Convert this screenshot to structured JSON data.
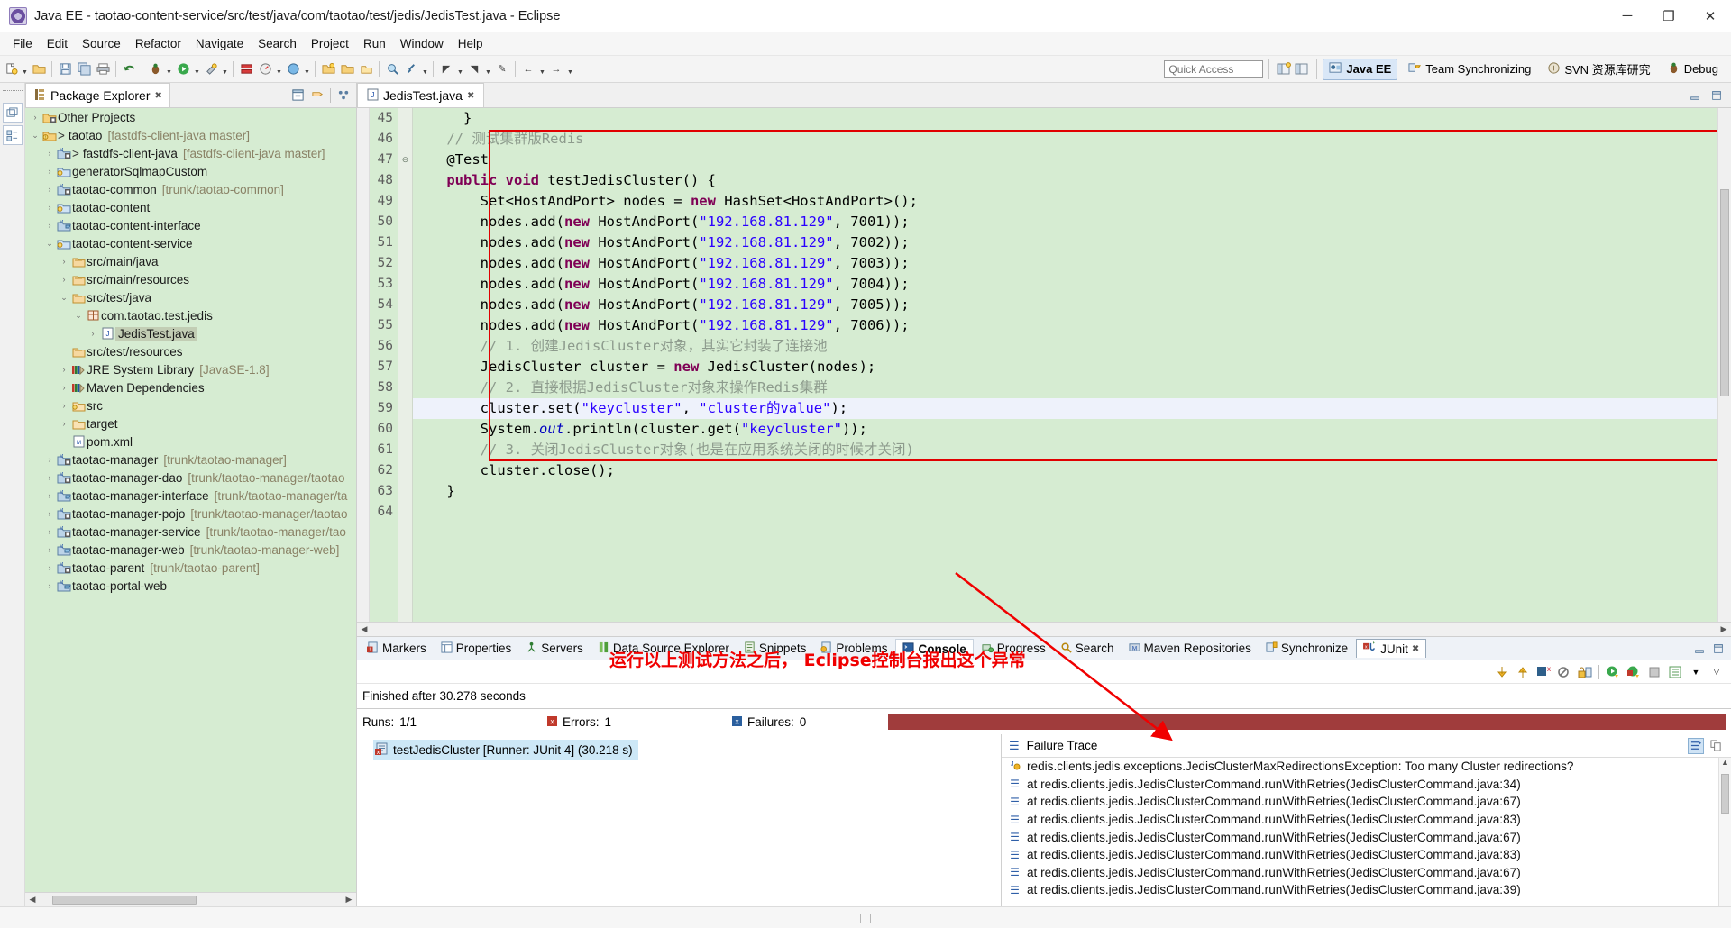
{
  "window": {
    "title": "Java EE - taotao-content-service/src/test/java/com/taotao/test/jedis/JedisTest.java - Eclipse",
    "app_icon": "eclipse-icon",
    "minimize": "─",
    "maximize": "❐",
    "close": "✕"
  },
  "menubar": [
    "File",
    "Edit",
    "Source",
    "Refactor",
    "Navigate",
    "Search",
    "Project",
    "Run",
    "Window",
    "Help"
  ],
  "toolbar": {
    "quick_access_placeholder": "Quick Access",
    "quick_access_value": "",
    "perspectives": [
      {
        "label": "Java EE",
        "icon": "java-ee-perspective-icon",
        "active": true
      },
      {
        "label": "Team Synchronizing",
        "icon": "team-sync-icon",
        "active": false
      },
      {
        "label": "SVN 资源库研究",
        "icon": "svn-icon",
        "active": false
      },
      {
        "label": "Debug",
        "icon": "debug-icon",
        "active": false
      }
    ]
  },
  "package_explorer": {
    "tab_label": "Package Explorer",
    "tab_icon": "package-explorer-icon",
    "close_icon": "✖",
    "tools": [
      "collapse-all-icon",
      "link-with-editor-icon",
      "view-menu-icon"
    ],
    "tree": [
      {
        "indent": 0,
        "twist": "›",
        "icon": "project-folder-icon",
        "label": "Other Projects",
        "suffix": "",
        "gt": false
      },
      {
        "indent": 0,
        "twist": "⌄",
        "icon": "project-open-icon",
        "label": "taotao",
        "suffix": "[fastdfs-client-java master]",
        "gt": true
      },
      {
        "indent": 1,
        "twist": "›",
        "icon": "maven-project-icon",
        "label": "fastdfs-client-java",
        "suffix": "[fastdfs-client-java master]",
        "gt": true
      },
      {
        "indent": 1,
        "twist": "›",
        "icon": "java-project-icon",
        "label": "generatorSqlmapCustom",
        "suffix": "",
        "gt": false
      },
      {
        "indent": 1,
        "twist": "›",
        "icon": "maven-project-icon",
        "label": "taotao-common",
        "suffix": "[trunk/taotao-common]",
        "gt": false
      },
      {
        "indent": 1,
        "twist": "›",
        "icon": "java-project-icon",
        "label": "taotao-content",
        "suffix": "",
        "gt": false
      },
      {
        "indent": 1,
        "twist": "›",
        "icon": "maven-project-icon2",
        "label": "taotao-content-interface",
        "suffix": "",
        "gt": false
      },
      {
        "indent": 1,
        "twist": "⌄",
        "icon": "java-project-icon",
        "label": "taotao-content-service",
        "suffix": "",
        "gt": false
      },
      {
        "indent": 2,
        "twist": "›",
        "icon": "source-folder-icon",
        "label": "src/main/java",
        "suffix": "",
        "gt": false
      },
      {
        "indent": 2,
        "twist": "›",
        "icon": "source-folder-icon",
        "label": "src/main/resources",
        "suffix": "",
        "gt": false
      },
      {
        "indent": 2,
        "twist": "⌄",
        "icon": "source-folder-icon",
        "label": "src/test/java",
        "suffix": "",
        "gt": false
      },
      {
        "indent": 3,
        "twist": "⌄",
        "icon": "package-icon",
        "label": "com.taotao.test.jedis",
        "suffix": "",
        "gt": false
      },
      {
        "indent": 4,
        "twist": "›",
        "icon": "java-file-icon",
        "label": "JedisTest.java",
        "suffix": "",
        "gt": false,
        "selected": true
      },
      {
        "indent": 2,
        "twist": "",
        "icon": "source-folder-icon",
        "label": "src/test/resources",
        "suffix": "",
        "gt": false
      },
      {
        "indent": 2,
        "twist": "›",
        "icon": "library-icon",
        "label": "JRE System Library",
        "suffix": "[JavaSE-1.8]",
        "gt": false
      },
      {
        "indent": 2,
        "twist": "›",
        "icon": "library-icon",
        "label": "Maven Dependencies",
        "suffix": "",
        "gt": false
      },
      {
        "indent": 2,
        "twist": "›",
        "icon": "folder-warn-icon",
        "label": "src",
        "suffix": "",
        "gt": false
      },
      {
        "indent": 2,
        "twist": "›",
        "icon": "folder-icon",
        "label": "target",
        "suffix": "",
        "gt": false
      },
      {
        "indent": 2,
        "twist": "",
        "icon": "xml-file-icon",
        "label": "pom.xml",
        "suffix": "",
        "gt": false
      },
      {
        "indent": 1,
        "twist": "›",
        "icon": "maven-project-icon",
        "label": "taotao-manager",
        "suffix": "[trunk/taotao-manager]",
        "gt": false
      },
      {
        "indent": 1,
        "twist": "›",
        "icon": "maven-project-icon",
        "label": "taotao-manager-dao",
        "suffix": "[trunk/taotao-manager/taotao",
        "gt": false
      },
      {
        "indent": 1,
        "twist": "›",
        "icon": "maven-project-icon2",
        "label": "taotao-manager-interface",
        "suffix": "[trunk/taotao-manager/ta",
        "gt": false
      },
      {
        "indent": 1,
        "twist": "›",
        "icon": "maven-project-icon",
        "label": "taotao-manager-pojo",
        "suffix": "[trunk/taotao-manager/taotao",
        "gt": false
      },
      {
        "indent": 1,
        "twist": "›",
        "icon": "maven-project-icon",
        "label": "taotao-manager-service",
        "suffix": "[trunk/taotao-manager/tao",
        "gt": false
      },
      {
        "indent": 1,
        "twist": "›",
        "icon": "web-project-icon",
        "label": "taotao-manager-web",
        "suffix": "[trunk/taotao-manager-web]",
        "gt": false
      },
      {
        "indent": 1,
        "twist": "›",
        "icon": "maven-project-icon",
        "label": "taotao-parent",
        "suffix": "[trunk/taotao-parent]",
        "gt": false
      },
      {
        "indent": 1,
        "twist": "›",
        "icon": "web-project-icon",
        "label": "taotao-portal-web",
        "suffix": "",
        "gt": false
      }
    ]
  },
  "editor": {
    "tab_label": "JedisTest.java",
    "tab_icon": "java-file-icon",
    "tab_close": "✖",
    "first_line_number": 45,
    "current_line": 59,
    "lines": [
      {
        "n": 45,
        "tokens": [
          {
            "t": "      }",
            "c": "plain"
          }
        ]
      },
      {
        "n": 46,
        "tokens": [
          {
            "t": "    ",
            "c": "plain"
          },
          {
            "t": "// 测试集群版Redis",
            "c": "cmt-grey"
          }
        ]
      },
      {
        "n": 47,
        "fold": true,
        "tokens": [
          {
            "t": "    ",
            "c": "plain"
          },
          {
            "t": "@Test",
            "c": "plain"
          }
        ]
      },
      {
        "n": 48,
        "tokens": [
          {
            "t": "    ",
            "c": "plain"
          },
          {
            "t": "public",
            "c": "kw"
          },
          {
            "t": " ",
            "c": "plain"
          },
          {
            "t": "void",
            "c": "kw"
          },
          {
            "t": " testJedisCluster() {",
            "c": "plain"
          }
        ]
      },
      {
        "n": 49,
        "tokens": [
          {
            "t": "        Set<HostAndPort> nodes = ",
            "c": "plain"
          },
          {
            "t": "new",
            "c": "kw"
          },
          {
            "t": " HashSet<HostAndPort>();",
            "c": "plain"
          }
        ]
      },
      {
        "n": 50,
        "tokens": [
          {
            "t": "        nodes.add(",
            "c": "plain"
          },
          {
            "t": "new",
            "c": "kw"
          },
          {
            "t": " HostAndPort(",
            "c": "plain"
          },
          {
            "t": "\"192.168.81.129\"",
            "c": "str"
          },
          {
            "t": ", 7001));",
            "c": "plain"
          }
        ]
      },
      {
        "n": 51,
        "tokens": [
          {
            "t": "        nodes.add(",
            "c": "plain"
          },
          {
            "t": "new",
            "c": "kw"
          },
          {
            "t": " HostAndPort(",
            "c": "plain"
          },
          {
            "t": "\"192.168.81.129\"",
            "c": "str"
          },
          {
            "t": ", 7002));",
            "c": "plain"
          }
        ]
      },
      {
        "n": 52,
        "tokens": [
          {
            "t": "        nodes.add(",
            "c": "plain"
          },
          {
            "t": "new",
            "c": "kw"
          },
          {
            "t": " HostAndPort(",
            "c": "plain"
          },
          {
            "t": "\"192.168.81.129\"",
            "c": "str"
          },
          {
            "t": ", 7003));",
            "c": "plain"
          }
        ]
      },
      {
        "n": 53,
        "tokens": [
          {
            "t": "        nodes.add(",
            "c": "plain"
          },
          {
            "t": "new",
            "c": "kw"
          },
          {
            "t": " HostAndPort(",
            "c": "plain"
          },
          {
            "t": "\"192.168.81.129\"",
            "c": "str"
          },
          {
            "t": ", 7004));",
            "c": "plain"
          }
        ]
      },
      {
        "n": 54,
        "tokens": [
          {
            "t": "        nodes.add(",
            "c": "plain"
          },
          {
            "t": "new",
            "c": "kw"
          },
          {
            "t": " HostAndPort(",
            "c": "plain"
          },
          {
            "t": "\"192.168.81.129\"",
            "c": "str"
          },
          {
            "t": ", 7005));",
            "c": "plain"
          }
        ]
      },
      {
        "n": 55,
        "tokens": [
          {
            "t": "        nodes.add(",
            "c": "plain"
          },
          {
            "t": "new",
            "c": "kw"
          },
          {
            "t": " HostAndPort(",
            "c": "plain"
          },
          {
            "t": "\"192.168.81.129\"",
            "c": "str"
          },
          {
            "t": ", 7006));",
            "c": "plain"
          }
        ]
      },
      {
        "n": 56,
        "tokens": [
          {
            "t": "        ",
            "c": "plain"
          },
          {
            "t": "// 1. 创建JedisCluster对象，其实它封装了连接池",
            "c": "cmt-grey"
          }
        ]
      },
      {
        "n": 57,
        "tokens": [
          {
            "t": "        JedisCluster cluster = ",
            "c": "plain"
          },
          {
            "t": "new",
            "c": "kw"
          },
          {
            "t": " JedisCluster(nodes);",
            "c": "plain"
          }
        ]
      },
      {
        "n": 58,
        "tokens": [
          {
            "t": "        ",
            "c": "plain"
          },
          {
            "t": "// 2. 直接根据JedisCluster对象来操作Redis集群",
            "c": "cmt-grey"
          }
        ]
      },
      {
        "n": 59,
        "tokens": [
          {
            "t": "        cluster.set(",
            "c": "plain"
          },
          {
            "t": "\"keycluster\"",
            "c": "str"
          },
          {
            "t": ", ",
            "c": "plain"
          },
          {
            "t": "\"cluster的value\"",
            "c": "str"
          },
          {
            "t": ");",
            "c": "plain"
          }
        ]
      },
      {
        "n": 60,
        "tokens": [
          {
            "t": "        System.",
            "c": "plain"
          },
          {
            "t": "out",
            "c": "sfield"
          },
          {
            "t": ".println(cluster.get(",
            "c": "plain"
          },
          {
            "t": "\"keycluster\"",
            "c": "str"
          },
          {
            "t": "));",
            "c": "plain"
          }
        ]
      },
      {
        "n": 61,
        "tokens": [
          {
            "t": "        ",
            "c": "plain"
          },
          {
            "t": "// 3. 关闭JedisCluster对象(也是在应用系统关闭的时候才关闭)",
            "c": "cmt-grey"
          }
        ]
      },
      {
        "n": 62,
        "tokens": [
          {
            "t": "        cluster.close();",
            "c": "plain"
          }
        ]
      },
      {
        "n": 63,
        "tokens": [
          {
            "t": "    }",
            "c": "plain"
          }
        ]
      },
      {
        "n": 64,
        "tokens": [
          {
            "t": "",
            "c": "plain"
          }
        ]
      }
    ]
  },
  "bottom_panel": {
    "tabs": [
      {
        "label": "Markers",
        "icon": "markers-icon",
        "active": false
      },
      {
        "label": "Properties",
        "icon": "properties-icon",
        "active": false
      },
      {
        "label": "Servers",
        "icon": "servers-icon",
        "active": false
      },
      {
        "label": "Data Source Explorer",
        "icon": "data-source-icon",
        "active": false
      },
      {
        "label": "Snippets",
        "icon": "snippets-icon",
        "active": false
      },
      {
        "label": "Problems",
        "icon": "problems-icon",
        "active": false
      },
      {
        "label": "Console",
        "icon": "console-icon",
        "active": true
      },
      {
        "label": "Progress",
        "icon": "progress-icon",
        "active": false
      },
      {
        "label": "Search",
        "icon": "search-icon",
        "active": false
      },
      {
        "label": "Maven Repositories",
        "icon": "maven-repo-icon",
        "active": false
      },
      {
        "label": "Synchronize",
        "icon": "synchronize-icon",
        "active": false
      },
      {
        "label": "JUnit",
        "icon": "junit-icon",
        "active": false,
        "selected": true,
        "close": "✖"
      }
    ],
    "panel_tools": [
      "minimize-icon",
      "maximize-icon"
    ],
    "junit_toolbar": [
      "next-failure-icon",
      "prev-failure-icon",
      "show-failures-icon",
      "show-skipped-icon",
      "lock-icon",
      "rerun-test-icon",
      "rerun-failed-icon",
      "stop-icon",
      "test-history-icon",
      "view-menu-dropdown-icon",
      "view-menu-icon"
    ],
    "junit": {
      "finished_text": "Finished after 30.278 seconds",
      "runs_label": "Runs:",
      "runs_value": "1/1",
      "errors_label": "Errors:",
      "errors_value": "1",
      "failures_label": "Failures:",
      "failures_value": "0",
      "progress_color": "#a03c3c",
      "test_item": {
        "icon": "test-error-icon",
        "label": "testJedisCluster [Runner: JUnit 4] (30.218 s)"
      },
      "failure_trace": {
        "title": "Failure Trace",
        "title_icon": "failure-trace-icon",
        "tools": [
          "filter-stack-trace-icon",
          "copy-trace-icon"
        ],
        "entries": [
          {
            "icon": "exception-icon",
            "text": "redis.clients.jedis.exceptions.JedisClusterMaxRedirectionsException: Too many Cluster redirections?"
          },
          {
            "icon": "stack-frame-icon",
            "text": "at redis.clients.jedis.JedisClusterCommand.runWithRetries(JedisClusterCommand.java:34)"
          },
          {
            "icon": "stack-frame-icon",
            "text": "at redis.clients.jedis.JedisClusterCommand.runWithRetries(JedisClusterCommand.java:67)"
          },
          {
            "icon": "stack-frame-icon",
            "text": "at redis.clients.jedis.JedisClusterCommand.runWithRetries(JedisClusterCommand.java:83)"
          },
          {
            "icon": "stack-frame-icon",
            "text": "at redis.clients.jedis.JedisClusterCommand.runWithRetries(JedisClusterCommand.java:67)"
          },
          {
            "icon": "stack-frame-icon",
            "text": "at redis.clients.jedis.JedisClusterCommand.runWithRetries(JedisClusterCommand.java:83)"
          },
          {
            "icon": "stack-frame-icon",
            "text": "at redis.clients.jedis.JedisClusterCommand.runWithRetries(JedisClusterCommand.java:67)"
          },
          {
            "icon": "stack-frame-icon",
            "text": "at redis.clients.jedis.JedisClusterCommand.runWithRetries(JedisClusterCommand.java:39)"
          }
        ]
      }
    }
  },
  "annotations": {
    "note_text": "运行以上测试方法之后， Eclipse控制台报出这个异常",
    "note_color": "#f00000",
    "code_highlight_color": "#e00000"
  }
}
